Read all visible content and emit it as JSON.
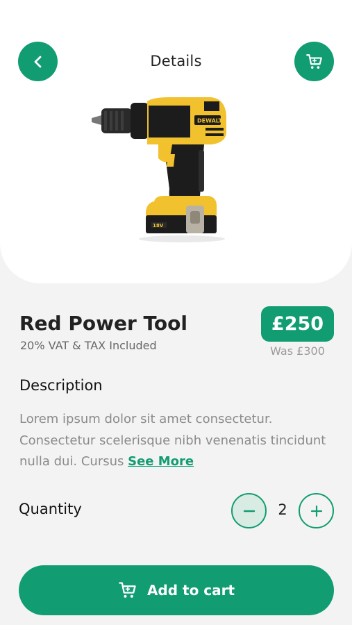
{
  "header": {
    "title": "Details",
    "back_icon": "chevron-left-icon",
    "cart_icon": "cart-icon"
  },
  "product": {
    "name": "Red Power Tool",
    "vat_note": "20% VAT & TAX Included",
    "price": "£250",
    "was_price": "Was £300",
    "image_brand_text": "DEWALT",
    "image_battery_text": "18V"
  },
  "description": {
    "title": "Description",
    "text": "Lorem ipsum dolor sit amet consectetur. Consectetur scelerisque nibh venenatis tincidunt nulla dui. Cursus ",
    "see_more": "See More"
  },
  "quantity": {
    "label": "Quantity",
    "value": "2",
    "decrement_icon": "minus-icon",
    "increment_icon": "plus-icon"
  },
  "cta": {
    "label": "Add to cart",
    "icon": "cart-icon"
  },
  "colors": {
    "accent": "#119c72",
    "background": "#f3f3f3",
    "card": "#ffffff",
    "drill_yellow": "#f2c12e",
    "drill_black": "#1c1c1c"
  }
}
